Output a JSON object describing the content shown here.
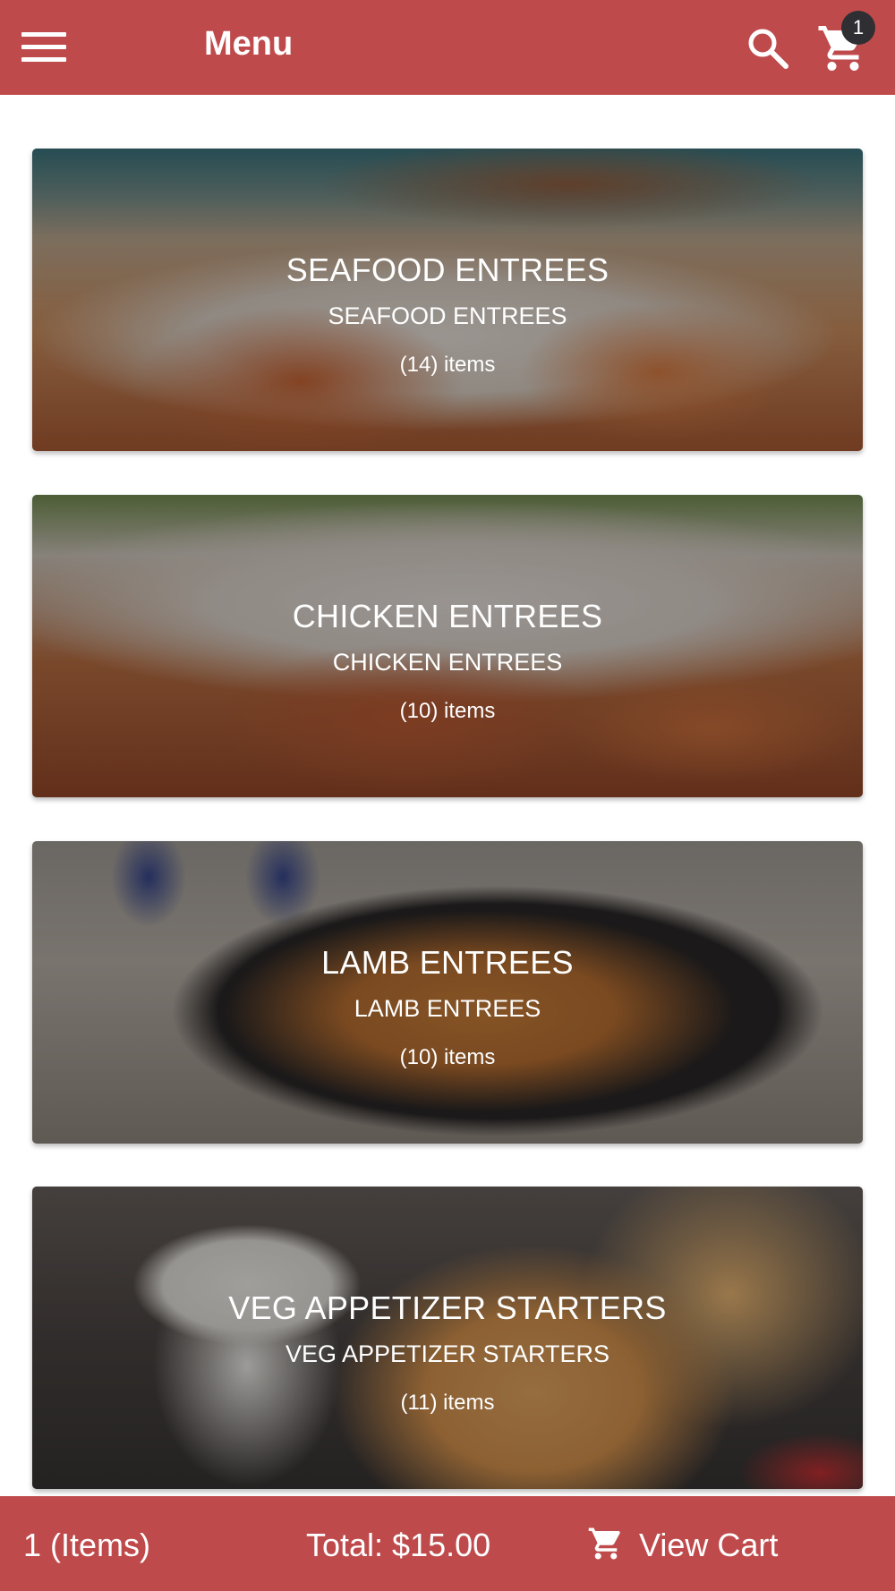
{
  "header": {
    "title": "Menu",
    "cart_count": "1"
  },
  "categories": [
    {
      "title": "SEAFOOD ENTREES",
      "subtitle": "SEAFOOD ENTREES",
      "count": "(14) items"
    },
    {
      "title": "CHICKEN ENTREES",
      "subtitle": "CHICKEN ENTREES",
      "count": "(10) items"
    },
    {
      "title": "LAMB ENTREES",
      "subtitle": "LAMB ENTREES",
      "count": "(10) items"
    },
    {
      "title": "VEG APPETIZER STARTERS",
      "subtitle": "VEG APPETIZER STARTERS",
      "count": "(11) items"
    }
  ],
  "footer": {
    "items": "1 (Items)",
    "total": "Total: $15.00",
    "view_cart": "View Cart"
  },
  "icons": {
    "menu": "hamburger-menu-icon",
    "search": "search-icon",
    "cart": "shopping-cart-icon"
  },
  "colors": {
    "primary": "#bf4a4b",
    "badge": "#2f2f33",
    "text_on_primary": "#ffffff"
  }
}
